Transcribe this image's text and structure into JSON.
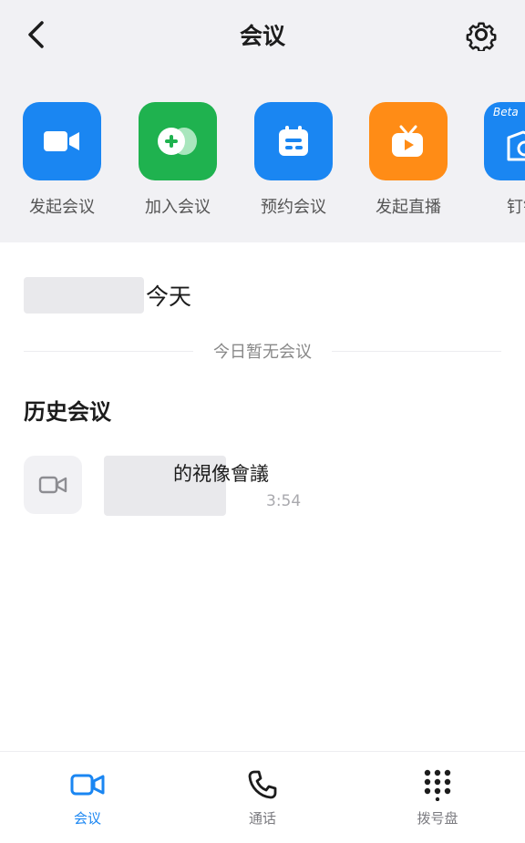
{
  "header": {
    "title": "会议"
  },
  "actions": [
    {
      "label": "发起会议",
      "color": "#1a86f2",
      "icon": "video-camera-icon"
    },
    {
      "label": "加入会议",
      "color": "#1fb24f",
      "icon": "join-plus-icon"
    },
    {
      "label": "预约会议",
      "color": "#1a86f2",
      "icon": "calendar-icon"
    },
    {
      "label": "发起直播",
      "color": "#ff8c16",
      "icon": "live-tv-icon"
    },
    {
      "label": "钉钉",
      "color": "#1a86f2",
      "icon": "beta-feature-icon",
      "badge": "Beta"
    }
  ],
  "today": {
    "label": "今天",
    "empty_text": "今日暂无会议"
  },
  "history": {
    "title": "历史会议",
    "items": [
      {
        "title": "的視像會議",
        "time": "3:54",
        "icon": "video-camera-icon"
      }
    ]
  },
  "tabbar": [
    {
      "label": "会议",
      "icon": "video-camera-icon",
      "active": true
    },
    {
      "label": "通话",
      "icon": "phone-icon",
      "active": false
    },
    {
      "label": "拨号盘",
      "icon": "dialpad-icon",
      "active": false
    }
  ],
  "colors": {
    "accent": "#1a86f2",
    "header_bg": "#f1f1f4",
    "green": "#1fb24f",
    "orange": "#ff8c16"
  }
}
